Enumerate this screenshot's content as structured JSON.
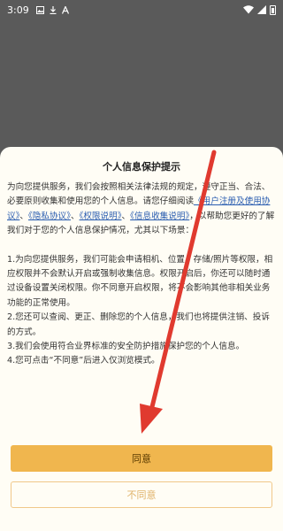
{
  "status_bar": {
    "time": "3:09",
    "icons": [
      "image-icon",
      "download-icon",
      "font-icon"
    ],
    "right_icons": [
      "wifi-icon",
      "signal-icon",
      "battery-icon"
    ]
  },
  "dialog": {
    "title": "个人信息保护提示",
    "intro": "为向您提供服务，我们会按照相关法律法规的规定，遵守正当、合法、必要原则收集和使用您的个人信息。请您仔细阅读",
    "links": [
      "《用户注册及使用协议》",
      "《隐私协议》",
      "《权限说明》",
      "《信息收集说明》"
    ],
    "separators": [
      "、",
      "、",
      "、"
    ],
    "intro_after_links": "，以帮助您更好的了解我们对于您的个人信息保护情况，尤其以下场景：",
    "items": [
      "1.为向您提供服务，我们可能会申请相机、位置、存储/照片等权限，相应权限并不会默认开启或强制收集信息。权限开启后，你还可以随时通过设备设置关闭权限。你不同意开启权限，将不会影响其他非相关业务功能的正常使用。",
      "2.您还可以查阅、更正、删除您的个人信息，我们也将提供注销、投诉的方式。",
      "3.我们会使用符合业界标准的安全防护措施保护您的个人信息。",
      "4.您可点击“不同意”后进入仅浏览模式。"
    ],
    "agree_label": "同意",
    "disagree_label": "不同意"
  },
  "colors": {
    "overlay": "#5a5a5a",
    "sheet": "#fffdf5",
    "agree": "#f0b64e",
    "disagree_border": "#f0c88a",
    "link": "#2a5db0",
    "arrow": "#e03a2f"
  }
}
